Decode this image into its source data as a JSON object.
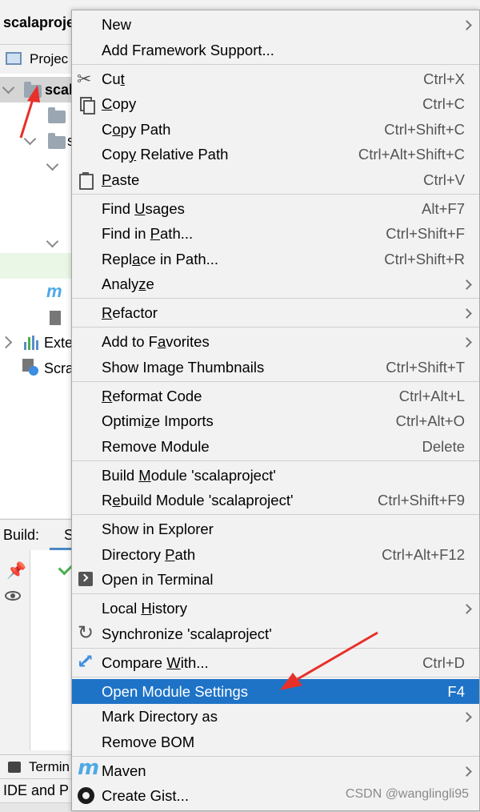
{
  "ide": {
    "window_title": "scalaproje",
    "project_panel_label": "Projec",
    "tree": {
      "root_label": "scal",
      "row_s": "s",
      "external_libraries": "Exte",
      "scratches": "Scra"
    },
    "build_label": "Build:",
    "build_tab": "S",
    "terminal_label": "Termin",
    "status_text": "IDE and P"
  },
  "context_menu": {
    "items": [
      {
        "label": "New",
        "shortcut": "",
        "submenu": true
      },
      {
        "label": "Add Framework Support...",
        "shortcut": ""
      },
      {
        "label_pre": "Cu",
        "label_u": "t",
        "label_post": "",
        "shortcut": "Ctrl+X",
        "icon": "scissors-icon"
      },
      {
        "label_pre": "",
        "label_u": "C",
        "label_post": "opy",
        "shortcut": "Ctrl+C",
        "icon": "copy-icon"
      },
      {
        "label_pre": "C",
        "label_u": "o",
        "label_post": "py Path",
        "shortcut": "Ctrl+Shift+C"
      },
      {
        "label_pre": "Cop",
        "label_u": "y",
        "label_post": " Relative Path",
        "shortcut": "Ctrl+Alt+Shift+C"
      },
      {
        "label_pre": "",
        "label_u": "P",
        "label_post": "aste",
        "shortcut": "Ctrl+V",
        "icon": "paste-icon"
      },
      {
        "label_pre": "Find ",
        "label_u": "U",
        "label_post": "sages",
        "shortcut": "Alt+F7"
      },
      {
        "label_pre": "Find in ",
        "label_u": "P",
        "label_post": "ath...",
        "shortcut": "Ctrl+Shift+F"
      },
      {
        "label_pre": "Repl",
        "label_u": "a",
        "label_post": "ce in Path...",
        "shortcut": "Ctrl+Shift+R"
      },
      {
        "label_pre": "Analy",
        "label_u": "z",
        "label_post": "e",
        "shortcut": "",
        "submenu": true
      },
      {
        "label_pre": "",
        "label_u": "R",
        "label_post": "efactor",
        "shortcut": "",
        "submenu": true
      },
      {
        "label_pre": "Add to F",
        "label_u": "a",
        "label_post": "vorites",
        "shortcut": "",
        "submenu": true
      },
      {
        "label": "Show Image Thumbnails",
        "shortcut": "Ctrl+Shift+T"
      },
      {
        "label_pre": "",
        "label_u": "R",
        "label_post": "eformat Code",
        "shortcut": "Ctrl+Alt+L"
      },
      {
        "label_pre": "Optimi",
        "label_u": "z",
        "label_post": "e Imports",
        "shortcut": "Ctrl+Alt+O"
      },
      {
        "label": "Remove Module",
        "shortcut": "Delete"
      },
      {
        "label_pre": "Build ",
        "label_u": "M",
        "label_post": "odule 'scalaproject'",
        "shortcut": ""
      },
      {
        "label_pre": "R",
        "label_u": "e",
        "label_post": "build Module 'scalaproject'",
        "shortcut": "Ctrl+Shift+F9"
      },
      {
        "label": "Show in Explorer",
        "shortcut": ""
      },
      {
        "label_pre": "Directory ",
        "label_u": "P",
        "label_post": "ath",
        "shortcut": "Ctrl+Alt+F12"
      },
      {
        "label": "Open in Terminal",
        "shortcut": "",
        "icon": "terminal-icon"
      },
      {
        "label_pre": "Local ",
        "label_u": "H",
        "label_post": "istory",
        "shortcut": "",
        "submenu": true
      },
      {
        "label": "Synchronize 'scalaproject'",
        "shortcut": "",
        "icon": "synchronize-icon"
      },
      {
        "label_pre": "Compare ",
        "label_u": "W",
        "label_post": "ith...",
        "shortcut": "Ctrl+D",
        "icon": "compare-icon"
      },
      {
        "label": "Open Module Settings",
        "shortcut": "F4",
        "highlighted": true
      },
      {
        "label": "Mark Directory as",
        "shortcut": "",
        "submenu": true
      },
      {
        "label": "Remove BOM",
        "shortcut": ""
      },
      {
        "label": "Maven",
        "shortcut": "",
        "submenu": true,
        "icon": "maven-icon"
      },
      {
        "label": "Create Gist...",
        "shortcut": "",
        "icon": "github-icon"
      }
    ]
  },
  "watermark": "CSDN @wanglingli95",
  "colors": {
    "menu_background": "#f2f2f2",
    "highlight": "#1e73c7",
    "annotation_arrow": "#e8302a"
  }
}
